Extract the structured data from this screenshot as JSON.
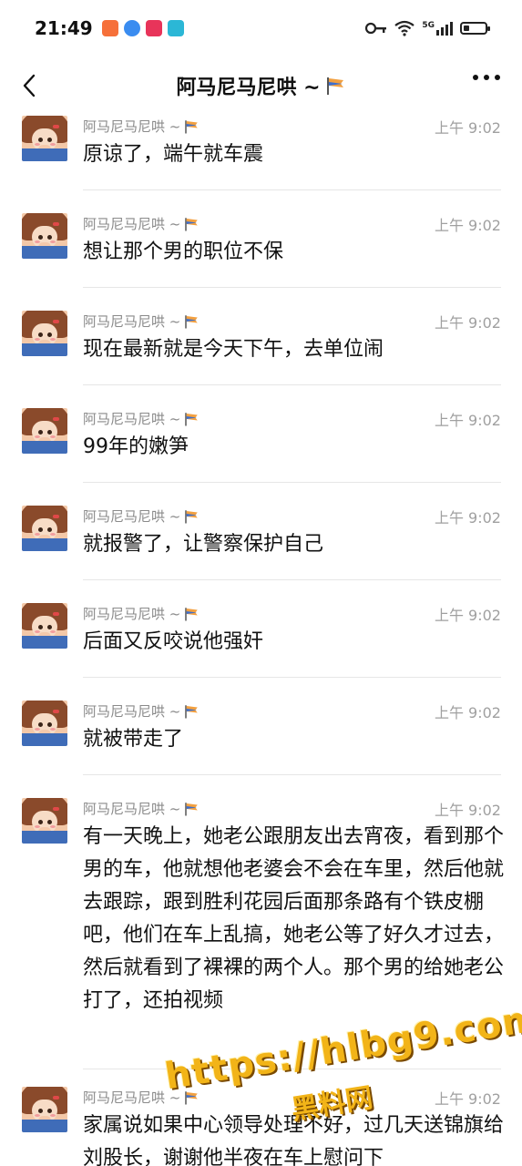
{
  "status_bar": {
    "time": "21:49",
    "app_icons": [
      {
        "name": "heart-app-icon",
        "color": "#f6703a"
      },
      {
        "name": "blue-drop-app-icon",
        "color": "#3a8cf0"
      },
      {
        "name": "play-app-icon",
        "color": "#e8345a"
      },
      {
        "name": "book-app-icon",
        "color": "#2bb7d6"
      }
    ],
    "network_label": "5G",
    "battery_level": 0.25
  },
  "header": {
    "title": "阿马尼马尼哄 ~",
    "flag_icon": "flag-icon"
  },
  "messages": [
    {
      "nickname": "阿马尼马尼哄 ~",
      "time": "上午 9:02",
      "text": "原谅了，端午就车震"
    },
    {
      "nickname": "阿马尼马尼哄 ~",
      "time": "上午 9:02",
      "text": "想让那个男的职位不保"
    },
    {
      "nickname": "阿马尼马尼哄 ~",
      "time": "上午 9:02",
      "text": "现在最新就是今天下午，去单位闹"
    },
    {
      "nickname": "阿马尼马尼哄 ~",
      "time": "上午 9:02",
      "text": "99年的嫩笋"
    },
    {
      "nickname": "阿马尼马尼哄 ~",
      "time": "上午 9:02",
      "text": "就报警了，让警察保护自己"
    },
    {
      "nickname": "阿马尼马尼哄 ~",
      "time": "上午 9:02",
      "text": "后面又反咬说他强奸"
    },
    {
      "nickname": "阿马尼马尼哄 ~",
      "time": "上午 9:02",
      "text": "就被带走了"
    },
    {
      "nickname": "阿马尼马尼哄 ~",
      "time": "上午 9:02",
      "text": "有一天晚上，她老公跟朋友出去宵夜，看到那个男的车，他就想他老婆会不会在车里，然后他就去跟踪，跟到胜利花园后面那条路有个铁皮棚吧，他们在车上乱搞，她老公等了好久才过去，然后就看到了裸裸的两个人。那个男的给她老公打了，还拍视频"
    },
    {
      "nickname": "阿马尼马尼哄 ~",
      "time": "上午 9:02",
      "text": "家属说如果中心领导处理不好，过几天送锦旗给刘股长，谢谢他半夜在车上慰问下"
    }
  ],
  "watermark": {
    "url": "https://hlbg9.com",
    "label": "黑料网"
  }
}
